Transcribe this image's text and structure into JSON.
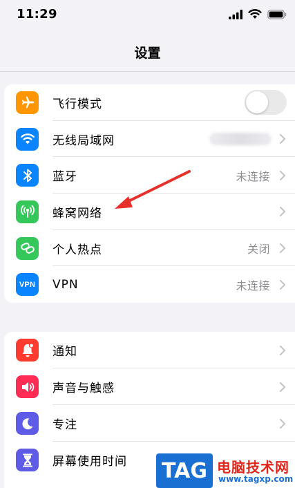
{
  "status_bar": {
    "time": "11:29"
  },
  "nav": {
    "title": "设置"
  },
  "group1": [
    {
      "label": "飞行模式",
      "icon": "airplane-icon",
      "color": "#ff9500",
      "control": "toggle",
      "toggle_on": false
    },
    {
      "label": "无线局域网",
      "icon": "wifi-icon",
      "color": "#0a84ff",
      "control": "blurred"
    },
    {
      "label": "蓝牙",
      "icon": "bluetooth-icon",
      "color": "#0a84ff",
      "value": "未连接"
    },
    {
      "label": "蜂窝网络",
      "icon": "antenna-icon",
      "color": "#34c759",
      "value": ""
    },
    {
      "label": "个人热点",
      "icon": "hotspot-icon",
      "color": "#34c759",
      "value": "关闭"
    },
    {
      "label": "VPN",
      "icon": "vpn-icon",
      "color": "#0a84ff",
      "icon_text": "VPN",
      "value": "未连接"
    }
  ],
  "group2": [
    {
      "label": "通知",
      "icon": "bell-icon",
      "color": "#ff3b30"
    },
    {
      "label": "声音与触感",
      "icon": "speaker-icon",
      "color": "#ff2d55"
    },
    {
      "label": "专注",
      "icon": "moon-icon",
      "color": "#5e5ce6"
    },
    {
      "label": "屏幕使用时间",
      "icon": "hourglass-icon",
      "color": "#5e5ce6"
    }
  ],
  "annotation": {
    "color": "#e8302b"
  },
  "watermark": {
    "tag": "TAG",
    "site": "电脑技术网",
    "url": "www.tagxp.com"
  }
}
